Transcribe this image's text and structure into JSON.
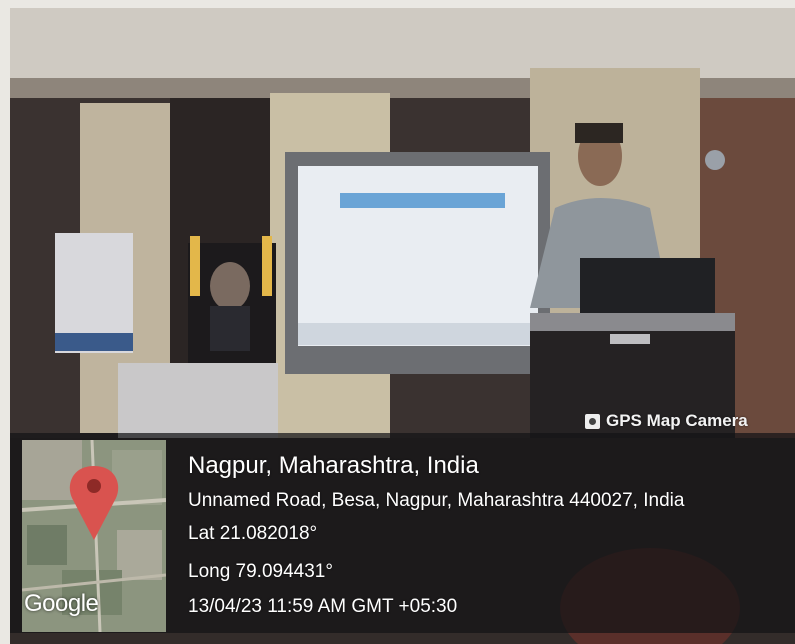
{
  "watermark": {
    "badge_label": "GPS Map Camera",
    "location_title": "Nagpur, Maharashtra, India",
    "address": "Unnamed Road, Besa, Nagpur, Maharashtra 440027, India",
    "latitude": "Lat 21.082018°",
    "longitude": "Long 79.094431°",
    "timestamp": "13/04/23 11:59 AM GMT +05:30",
    "map_attribution": "Google",
    "pin_color": "#d9534f"
  }
}
